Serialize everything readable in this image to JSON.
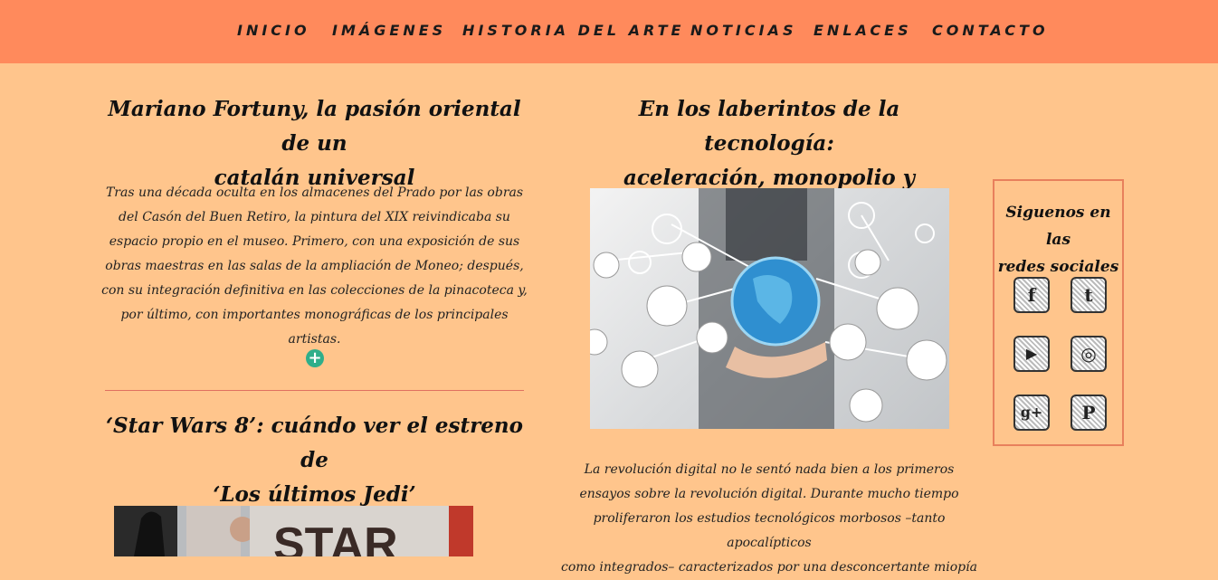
{
  "nav": {
    "items": [
      {
        "label": "INICIO"
      },
      {
        "label": "IMÁGENES"
      },
      {
        "label": "HISTORIA DEL ARTE"
      },
      {
        "label": "NOTICIAS"
      },
      {
        "label": "ENLACES"
      },
      {
        "label": "CONTACTO"
      }
    ]
  },
  "article1": {
    "title_line1": "Mariano Fortuny, la pasión oriental de un",
    "title_line2": "catalán universal",
    "body_lines": [
      "Tras una década oculta en los almacenes del Prado por las obras",
      "del Casón del Buen Retiro, la pintura del XIX reivindicaba su",
      "espacio propio en el museo. Primero, con una exposición de sus",
      "obras maestras en las salas de la ampliación de Moneo; después,",
      "con su integración definitiva en las colecciones de la pinacoteca y,",
      "por último, con importantes monográficas de los principales artistas."
    ],
    "more": "+"
  },
  "article2": {
    "title_line1": "‘Star Wars 8’: cuándo ver el estreno de",
    "title_line2": "‘Los últimos Jedi’",
    "image_text": "STAR"
  },
  "article3": {
    "title_line1": "En los laberintos de la tecnología:",
    "title_line2": "aceleración, monopolio y precariedad",
    "body_lines": [
      "La revolución digital no le sentó nada bien a los primeros",
      "ensayos sobre la revolución digital. Durante mucho tiempo",
      "proliferaron los estudios tecnológicos morbosos –tanto apocalípticos",
      "como integrados– caracterizados por una desconcertante miopía"
    ]
  },
  "social": {
    "title_line1": "Siguenos en las",
    "title_line2": "redes sociales",
    "icons": [
      {
        "name": "facebook-icon",
        "glyph": "f"
      },
      {
        "name": "tumblr-icon",
        "glyph": "t"
      },
      {
        "name": "youtube-icon",
        "glyph": "▶"
      },
      {
        "name": "instagram-icon",
        "glyph": "◎"
      },
      {
        "name": "googleplus-icon",
        "glyph": "g+"
      },
      {
        "name": "pinterest-icon",
        "glyph": "P"
      }
    ]
  },
  "colors": {
    "header": "#ff8a5c",
    "background": "#ffc58c",
    "accent": "#2fae8a",
    "border": "#e8805c"
  }
}
